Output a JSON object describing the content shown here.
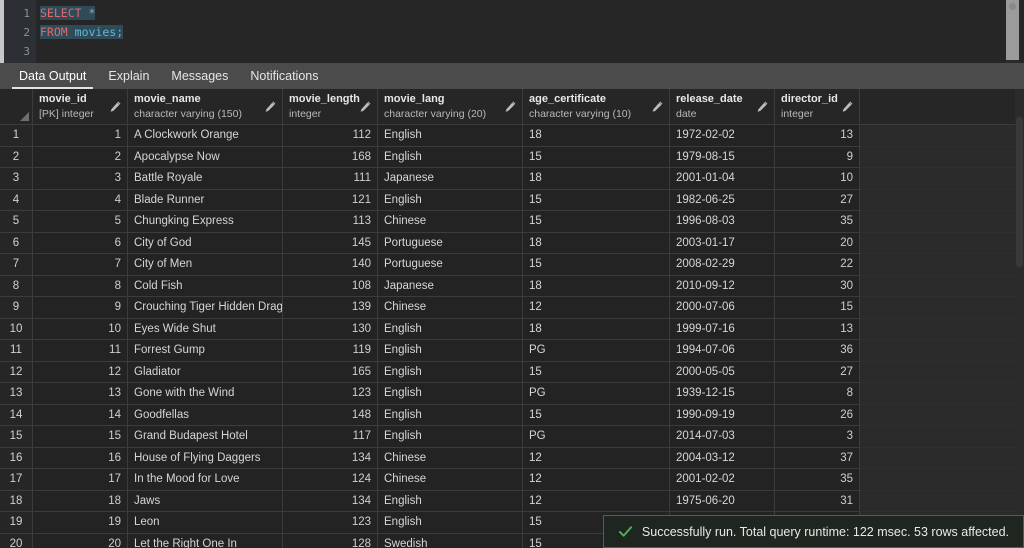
{
  "editor": {
    "lines": [
      "1",
      "2",
      "3"
    ],
    "line1": {
      "keyword": "SELECT",
      "operator": "*"
    },
    "line2": {
      "keyword": "FROM",
      "identifier": "movies",
      "terminator": ";"
    },
    "query_text": "SELECT *\nFROM movies;"
  },
  "tabs": [
    {
      "label": "Data Output",
      "active": true
    },
    {
      "label": "Explain",
      "active": false
    },
    {
      "label": "Messages",
      "active": false
    },
    {
      "label": "Notifications",
      "active": false
    }
  ],
  "grid": {
    "columns": [
      {
        "name": "movie_id",
        "type": "[PK] integer",
        "align": "right"
      },
      {
        "name": "movie_name",
        "type": "character varying (150)",
        "align": "left"
      },
      {
        "name": "movie_length",
        "type": "integer",
        "align": "right"
      },
      {
        "name": "movie_lang",
        "type": "character varying (20)",
        "align": "left"
      },
      {
        "name": "age_certificate",
        "type": "character varying (10)",
        "align": "left"
      },
      {
        "name": "release_date",
        "type": "date",
        "align": "left"
      },
      {
        "name": "director_id",
        "type": "integer",
        "align": "right"
      }
    ],
    "rows": [
      {
        "n": "1",
        "movie_id": "1",
        "movie_name": "A Clockwork Orange",
        "movie_length": "112",
        "movie_lang": "English",
        "age_certificate": "18",
        "release_date": "1972-02-02",
        "director_id": "13"
      },
      {
        "n": "2",
        "movie_id": "2",
        "movie_name": "Apocalypse Now",
        "movie_length": "168",
        "movie_lang": "English",
        "age_certificate": "15",
        "release_date": "1979-08-15",
        "director_id": "9"
      },
      {
        "n": "3",
        "movie_id": "3",
        "movie_name": "Battle Royale",
        "movie_length": "111",
        "movie_lang": "Japanese",
        "age_certificate": "18",
        "release_date": "2001-01-04",
        "director_id": "10"
      },
      {
        "n": "4",
        "movie_id": "4",
        "movie_name": "Blade Runner",
        "movie_length": "121",
        "movie_lang": "English",
        "age_certificate": "15",
        "release_date": "1982-06-25",
        "director_id": "27"
      },
      {
        "n": "5",
        "movie_id": "5",
        "movie_name": "Chungking Express",
        "movie_length": "113",
        "movie_lang": "Chinese",
        "age_certificate": "15",
        "release_date": "1996-08-03",
        "director_id": "35"
      },
      {
        "n": "6",
        "movie_id": "6",
        "movie_name": "City of God",
        "movie_length": "145",
        "movie_lang": "Portuguese",
        "age_certificate": "18",
        "release_date": "2003-01-17",
        "director_id": "20"
      },
      {
        "n": "7",
        "movie_id": "7",
        "movie_name": "City of Men",
        "movie_length": "140",
        "movie_lang": "Portuguese",
        "age_certificate": "15",
        "release_date": "2008-02-29",
        "director_id": "22"
      },
      {
        "n": "8",
        "movie_id": "8",
        "movie_name": "Cold Fish",
        "movie_length": "108",
        "movie_lang": "Japanese",
        "age_certificate": "18",
        "release_date": "2010-09-12",
        "director_id": "30"
      },
      {
        "n": "9",
        "movie_id": "9",
        "movie_name": "Crouching Tiger Hidden Dragon",
        "movie_length": "139",
        "movie_lang": "Chinese",
        "age_certificate": "12",
        "release_date": "2000-07-06",
        "director_id": "15"
      },
      {
        "n": "10",
        "movie_id": "10",
        "movie_name": "Eyes Wide Shut",
        "movie_length": "130",
        "movie_lang": "English",
        "age_certificate": "18",
        "release_date": "1999-07-16",
        "director_id": "13"
      },
      {
        "n": "11",
        "movie_id": "11",
        "movie_name": "Forrest Gump",
        "movie_length": "119",
        "movie_lang": "English",
        "age_certificate": "PG",
        "release_date": "1994-07-06",
        "director_id": "36"
      },
      {
        "n": "12",
        "movie_id": "12",
        "movie_name": "Gladiator",
        "movie_length": "165",
        "movie_lang": "English",
        "age_certificate": "15",
        "release_date": "2000-05-05",
        "director_id": "27"
      },
      {
        "n": "13",
        "movie_id": "13",
        "movie_name": "Gone with the Wind",
        "movie_length": "123",
        "movie_lang": "English",
        "age_certificate": "PG",
        "release_date": "1939-12-15",
        "director_id": "8"
      },
      {
        "n": "14",
        "movie_id": "14",
        "movie_name": "Goodfellas",
        "movie_length": "148",
        "movie_lang": "English",
        "age_certificate": "15",
        "release_date": "1990-09-19",
        "director_id": "26"
      },
      {
        "n": "15",
        "movie_id": "15",
        "movie_name": "Grand Budapest Hotel",
        "movie_length": "117",
        "movie_lang": "English",
        "age_certificate": "PG",
        "release_date": "2014-07-03",
        "director_id": "3"
      },
      {
        "n": "16",
        "movie_id": "16",
        "movie_name": "House of Flying Daggers",
        "movie_length": "134",
        "movie_lang": "Chinese",
        "age_certificate": "12",
        "release_date": "2004-03-12",
        "director_id": "37"
      },
      {
        "n": "17",
        "movie_id": "17",
        "movie_name": "In the Mood for Love",
        "movie_length": "124",
        "movie_lang": "Chinese",
        "age_certificate": "12",
        "release_date": "2001-02-02",
        "director_id": "35"
      },
      {
        "n": "18",
        "movie_id": "18",
        "movie_name": "Jaws",
        "movie_length": "134",
        "movie_lang": "English",
        "age_certificate": "12",
        "release_date": "1975-06-20",
        "director_id": "31"
      },
      {
        "n": "19",
        "movie_id": "19",
        "movie_name": "Leon",
        "movie_length": "123",
        "movie_lang": "English",
        "age_certificate": "15",
        "release_date": "",
        "director_id": ""
      },
      {
        "n": "20",
        "movie_id": "20",
        "movie_name": "Let the Right One In",
        "movie_length": "128",
        "movie_lang": "Swedish",
        "age_certificate": "15",
        "release_date": "",
        "director_id": ""
      }
    ]
  },
  "toast": {
    "message": "Successfully run. Total query runtime: 122 msec. 53 rows affected.",
    "status": "success",
    "accent_color": "#4caf50"
  }
}
